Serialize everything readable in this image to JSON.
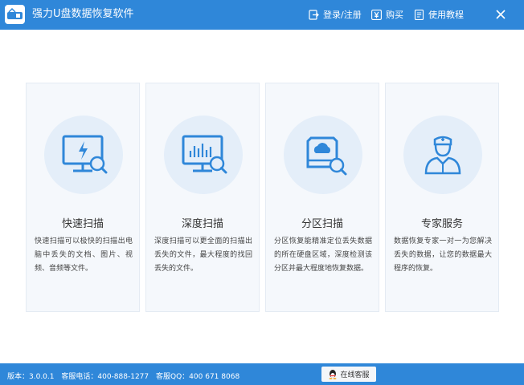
{
  "app": {
    "title": "强力U盘数据恢复软件"
  },
  "header": {
    "login_label": "登录/注册",
    "buy_label": "购买",
    "help_label": "使用教程"
  },
  "cards": [
    {
      "title": "快速扫描",
      "desc": "快速扫描可以极快的扫描出电脑中丢失的文档、图片、视频、音频等文件。",
      "icon": "monitor-lightning-icon"
    },
    {
      "title": "深度扫描",
      "desc": "深度扫描可以更全面的扫描出丢失的文件，最大程度的找回丢失的文件。",
      "icon": "monitor-chart-icon"
    },
    {
      "title": "分区扫描",
      "desc": "分区恢复能精准定位丢失数据的所在硬盘区域，深度检测该分区并最大程度地恢复数据。",
      "icon": "disk-cloud-icon"
    },
    {
      "title": "专家服务",
      "desc": "数据恢复专家一对一为您解决丢失的数据，让您的数据最大程序的恢复。",
      "icon": "doctor-icon"
    }
  ],
  "status": {
    "version": "版本：3.0.0.1",
    "phone": "客服电话：400-888-1277",
    "qq": "客服QQ：400 671 8068",
    "online_label": "在线客服"
  },
  "colors": {
    "accent": "#2f87d9",
    "icon_blue": "#2f87d9",
    "card_bg": "#f5f8fc",
    "circle_bg": "#e4eef9"
  }
}
